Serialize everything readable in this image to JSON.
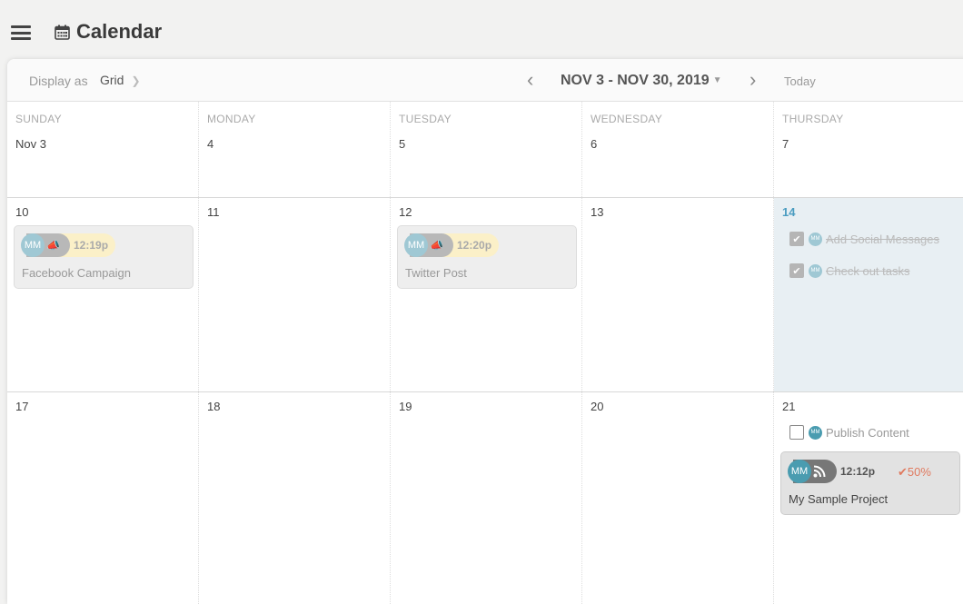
{
  "header": {
    "title": "Calendar",
    "menu_icon": "hamburger-icon",
    "calendar_icon": "calendar-icon"
  },
  "toolbar": {
    "display_as_label": "Display as",
    "display_value": "Grid",
    "date_range": "NOV 3 - NOV 30, 2019",
    "today_label": "Today"
  },
  "weekdays": [
    "SUNDAY",
    "MONDAY",
    "TUESDAY",
    "WEDNESDAY",
    "THURSDAY"
  ],
  "weeks": [
    {
      "days": [
        "Nov 3",
        "4",
        "5",
        "6",
        "7"
      ]
    },
    {
      "days": [
        "10",
        "11",
        "12",
        "13",
        "14"
      ]
    },
    {
      "days": [
        "17",
        "18",
        "19",
        "20",
        "21"
      ]
    }
  ],
  "events": {
    "facebook": {
      "initials": "MM",
      "type_icon": "megaphone-icon",
      "time": "12:19p",
      "name": "Facebook Campaign"
    },
    "twitter": {
      "initials": "MM",
      "type_icon": "megaphone-icon",
      "time": "12:20p",
      "name": "Twitter Post"
    },
    "project": {
      "initials": "MM",
      "type_icon": "rss-icon",
      "time": "12:12p",
      "progress": "50%",
      "name": "My Sample Project"
    }
  },
  "tasks": {
    "t1": {
      "initials": "MM",
      "label": "Add Social Messages",
      "done": true
    },
    "t2": {
      "initials": "MM",
      "label": "Check out tasks",
      "done": true
    },
    "t3": {
      "initials": "MM",
      "label": "Publish Content",
      "done": false
    }
  },
  "colors": {
    "today": "#4a9cc0",
    "highlight": "#e8eff3",
    "progress": "#e07a5f",
    "avatar": "#9fc8d4",
    "avatar_active": "#4a9cb0"
  }
}
